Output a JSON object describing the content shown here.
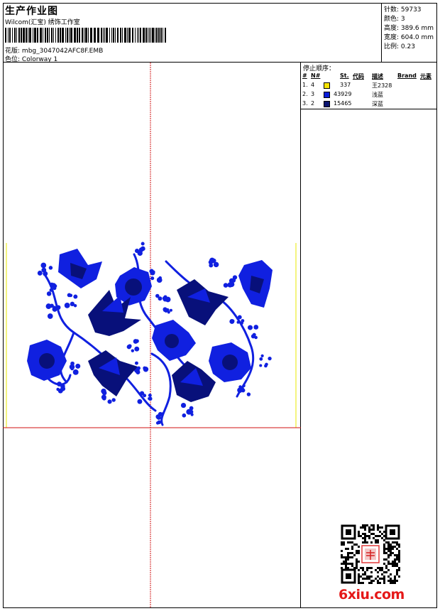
{
  "header": {
    "title": "生产作业图",
    "subtitle": "Wilcom(汇宝) 绣饰工作室",
    "design_label": "花版:",
    "design_value": "mbg_3047042AFC8F.EMB",
    "colorway_label": "色位:",
    "colorway_value": "Colorway 1"
  },
  "stats": {
    "stitches": "针数: 59733",
    "colors": "颜色: 3",
    "height": "高度: 389.6 mm",
    "width": "宽度: 604.0 mm",
    "ratio": "比例: 0.23"
  },
  "sequence": {
    "title": "停止顺序：",
    "headers": [
      "#",
      "N#",
      "St.",
      "代码",
      "描述",
      "Brand",
      "元素"
    ],
    "rows": [
      {
        "num": "1.",
        "needle": "4",
        "color": "#f5e400",
        "stitches": "337",
        "code": "",
        "desc": "王2328"
      },
      {
        "num": "2.",
        "needle": "3",
        "color": "#0a1ed8",
        "stitches": "43929",
        "code": "",
        "desc": "浅蓝"
      },
      {
        "num": "3.",
        "needle": "2",
        "color": "#0a1470",
        "stitches": "15465",
        "code": "",
        "desc": "深蓝"
      }
    ]
  },
  "watermark": "6xiu.com",
  "icons": {
    "qr": "qr-code-icon",
    "stamp": "seal-stamp-icon"
  },
  "colors": {
    "embroidery_light": "#1020e0",
    "embroidery_dark": "#08107a",
    "crosshair": "#d01010",
    "boundary": "#e8e800"
  }
}
